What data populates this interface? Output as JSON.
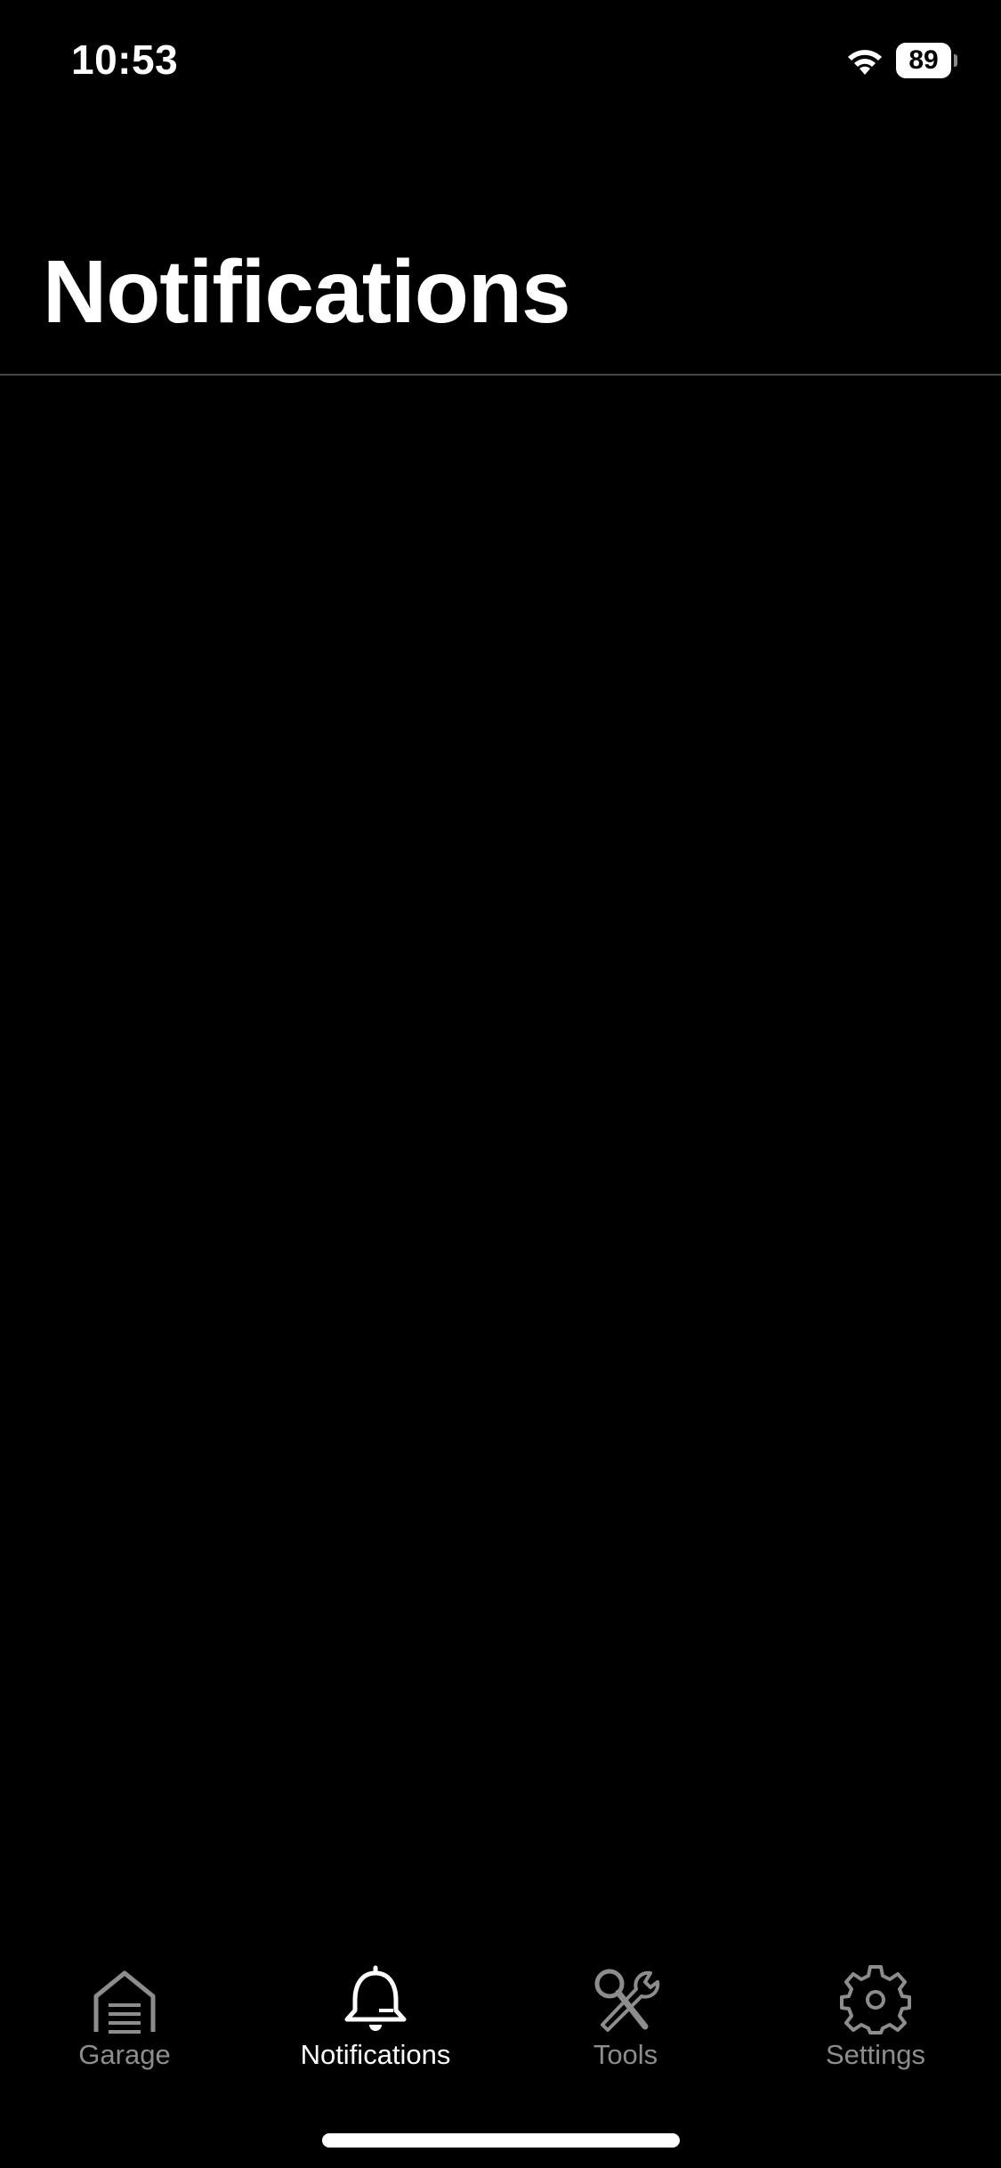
{
  "status_bar": {
    "time": "10:53",
    "battery_level": "89",
    "wifi_icon": "wifi-icon"
  },
  "header": {
    "title": "Notifications"
  },
  "tab_bar": {
    "tabs": [
      {
        "label": "Garage",
        "icon": "garage-icon",
        "active": false
      },
      {
        "label": "Notifications",
        "icon": "bell-icon",
        "active": true
      },
      {
        "label": "Tools",
        "icon": "tools-icon",
        "active": false
      },
      {
        "label": "Settings",
        "icon": "gear-icon",
        "active": false
      }
    ]
  },
  "colors": {
    "background": "#000000",
    "active_tab": "#ffffff",
    "inactive_tab": "#8d8d8d",
    "divider": "#48484a"
  }
}
